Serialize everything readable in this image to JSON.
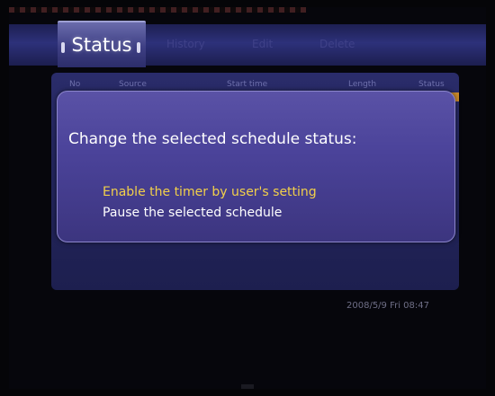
{
  "tabs": [
    {
      "label": "Status"
    },
    {
      "label": "History"
    },
    {
      "label": "Edit"
    },
    {
      "label": "Delete"
    }
  ],
  "table": {
    "columns": [
      "No",
      "Source",
      "Start time",
      "Length",
      "Status"
    ]
  },
  "dialog": {
    "title": "Change the selected schedule status:",
    "options": [
      {
        "label": "Enable the timer by user's setting"
      },
      {
        "label": "Pause the selected schedule"
      }
    ]
  },
  "footer": {
    "datetime": "2008/5/9 Fri 08:47"
  },
  "colors": {
    "selected_option": "#f2d04a",
    "dialog_background": "#4b439a",
    "tab_bar": "#2d317a",
    "highlight_row": "#c9892b"
  }
}
